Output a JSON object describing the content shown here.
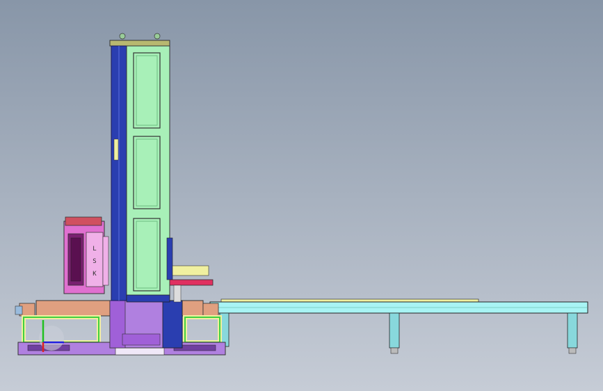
{
  "scene": {
    "background_top": "#8896a8",
    "background_bottom": "#c6ccd6",
    "column_labels": [
      "L",
      "S",
      "K"
    ],
    "colors": {
      "column_blue": "#2a3eb0",
      "column_panel": "#a8f0b8",
      "column_panel_dark": "#6dbb80",
      "mast_top": "#b8b870",
      "motor_pink": "#e070d0",
      "motor_light": "#f0b0e8",
      "base_orange": "#e0a080",
      "base_purple": "#b080e0",
      "frame_yellow": "#f0f0a0",
      "frame_green": "#40d040",
      "rail_cyan": "#a8f4f4",
      "leg_cyan": "#88d8dc",
      "carriage_red": "#e03060",
      "axis_x": "#e02020",
      "axis_y": "#20c020",
      "axis_z": "#2020e0"
    }
  }
}
